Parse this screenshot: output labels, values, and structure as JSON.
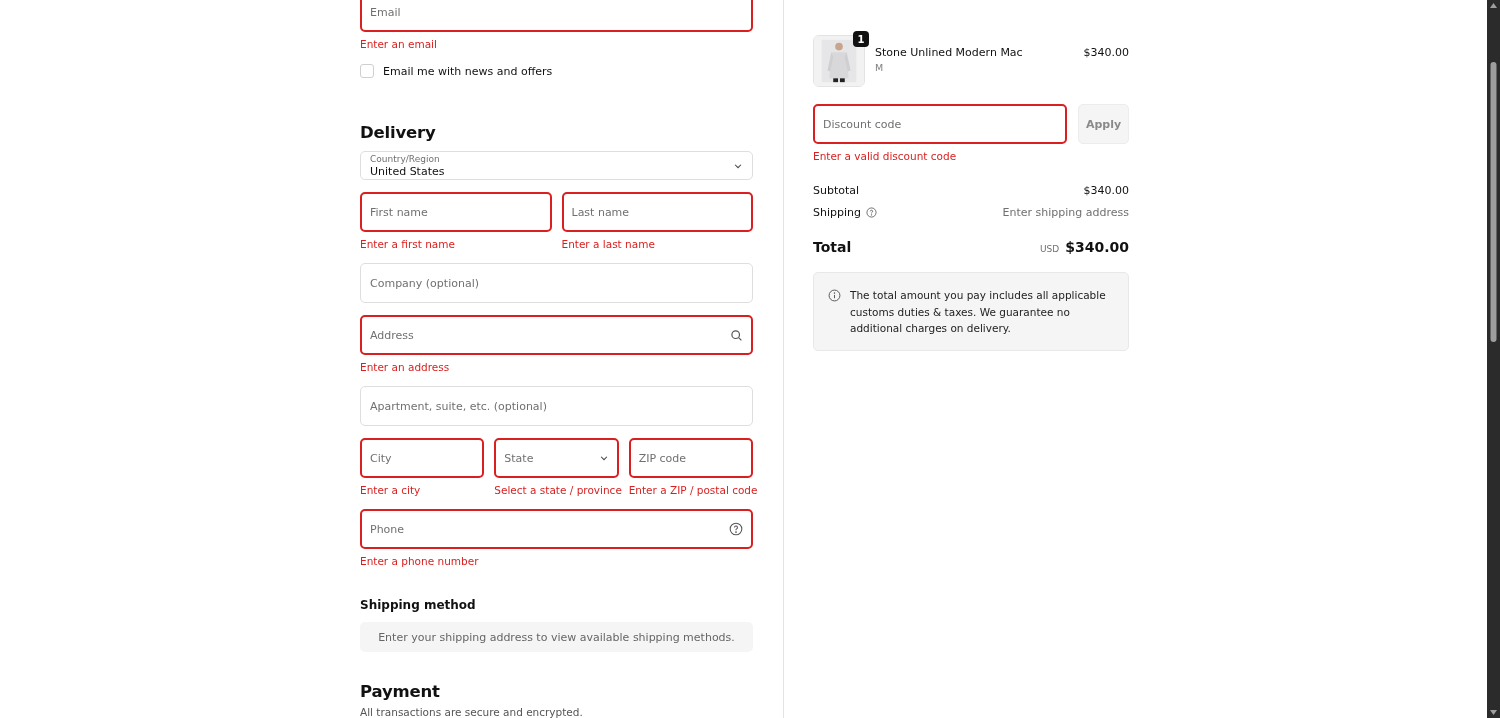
{
  "contact": {
    "email": {
      "kind": "text",
      "placeholder": "Email",
      "invalid": true,
      "error": "Enter an email"
    },
    "newsletter": {
      "label": "Email me with news and offers",
      "checked": false
    }
  },
  "delivery": {
    "heading": "Delivery",
    "country": {
      "label": "Country/Region",
      "value": "United States"
    },
    "rows": [
      [
        {
          "kind": "text",
          "placeholder": "First name",
          "invalid": true,
          "error": "Enter a first name"
        },
        {
          "kind": "text",
          "placeholder": "Last name",
          "invalid": true,
          "error": "Enter a last name"
        }
      ],
      [
        {
          "kind": "text",
          "placeholder": "Company (optional)",
          "invalid": false
        }
      ],
      [
        {
          "kind": "search",
          "placeholder": "Address",
          "invalid": true,
          "error": "Enter an address"
        }
      ],
      [
        {
          "kind": "text",
          "placeholder": "Apartment, suite, etc. (optional)",
          "invalid": false
        }
      ],
      [
        {
          "kind": "text",
          "placeholder": "City",
          "invalid": true,
          "error": "Enter a city"
        },
        {
          "kind": "select",
          "placeholder": "State",
          "invalid": true,
          "error": "Select a state / province"
        },
        {
          "kind": "text",
          "placeholder": "ZIP code",
          "invalid": true,
          "error": "Enter a ZIP / postal code"
        }
      ],
      [
        {
          "kind": "help",
          "placeholder": "Phone",
          "invalid": true,
          "error": "Enter a phone number"
        }
      ]
    ]
  },
  "shipping_method": {
    "heading": "Shipping method",
    "notice": "Enter your shipping address to view available shipping methods."
  },
  "payment": {
    "heading": "Payment",
    "subtitle": "All transactions are secure and encrypted."
  },
  "summary": {
    "item": {
      "kind": "picture",
      "quantity": "1",
      "name": "Stone Unlined Modern Mac",
      "variant": "M",
      "price": "$340.00"
    },
    "discount": {
      "placeholder": "Discount code",
      "invalid": true,
      "error": "Enter a valid discount code",
      "button": "Apply",
      "button_disabled": true
    },
    "lines": [
      {
        "label": "Subtotal",
        "value": "$340.00",
        "help": false,
        "muted": false
      },
      {
        "label": "Shipping",
        "value": "Enter shipping address",
        "help": true,
        "muted": true
      }
    ],
    "total": {
      "label": "Total",
      "currency": "USD",
      "amount": "$340.00"
    },
    "notice": "The total amount you pay includes all applicable customs duties & taxes. We guarantee no additional charges on delivery."
  }
}
